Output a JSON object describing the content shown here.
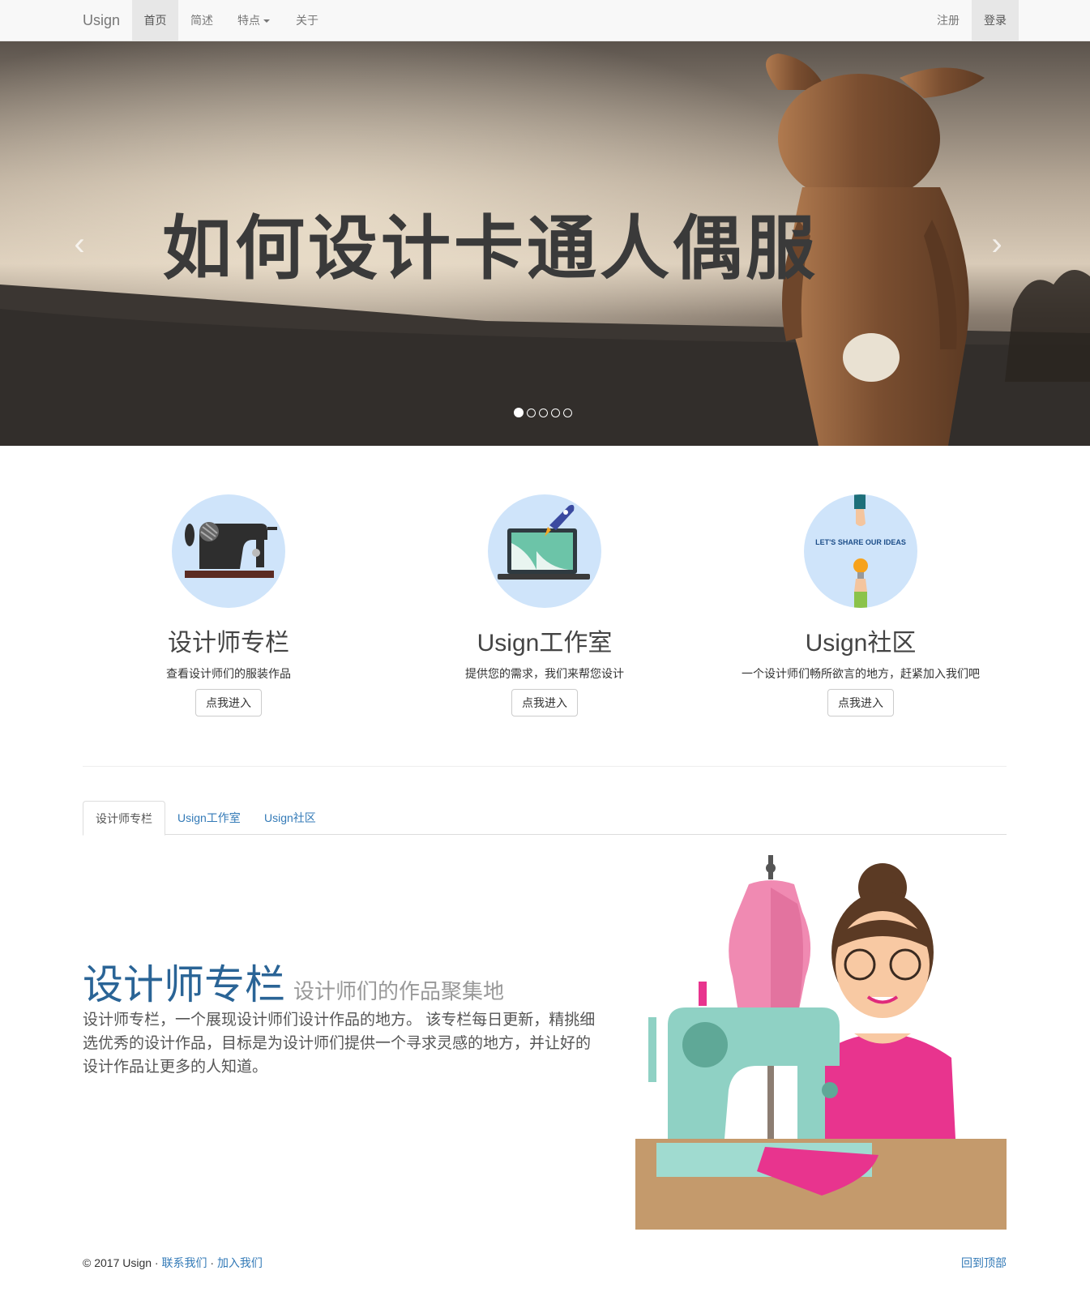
{
  "navbar": {
    "brand": "Usign",
    "items": [
      {
        "label": "首页",
        "active": true
      },
      {
        "label": "简述"
      },
      {
        "label": "特点"
      },
      {
        "label": "关于"
      }
    ],
    "right": [
      {
        "label": "注册"
      },
      {
        "label": "登录",
        "active": true
      }
    ]
  },
  "carousel": {
    "title": "如何设计卡通人偶服",
    "prev": "‹",
    "next": "›",
    "slides": 5,
    "active_slide": 1
  },
  "marketing": [
    {
      "title": "设计师专栏",
      "text": "查看设计师们的服装作品",
      "button": "点我进入",
      "icon": "sewing-machine-icon"
    },
    {
      "title": "Usign工作室",
      "text": "提供您的需求，我们来帮您设计",
      "button": "点我进入",
      "icon": "laptop-rocket-icon"
    },
    {
      "title": "Usign社区",
      "text": "一个设计师们畅所欲言的地方，赶紧加入我们吧",
      "button": "点我进入",
      "icon": "share-ideas-icon",
      "icon_text": "LET'S SHARE OUR IDEAS"
    }
  ],
  "tabs": [
    {
      "label": "设计师专栏",
      "active": true
    },
    {
      "label": "Usign工作室"
    },
    {
      "label": "Usign社区"
    }
  ],
  "feature": {
    "heading": "设计师专栏",
    "subheading": "设计师们的作品聚集地",
    "lead": "设计师专栏，一个展现设计师们设计作品的地方。 该专栏每日更新，精挑细选优秀的设计作品，目标是为设计师们提供一个寻求灵感的地方，并让好的设计作品让更多的人知道。"
  },
  "footer": {
    "copyright": "© 2017 Usign ·",
    "contact": "联系我们",
    "sep": " · ",
    "join": "加入我们",
    "back_to_top": "回到顶部"
  },
  "colors": {
    "link": "#337ab7",
    "navbar_bg": "#f8f8f8",
    "circle_bg": "#cfe4fa"
  }
}
